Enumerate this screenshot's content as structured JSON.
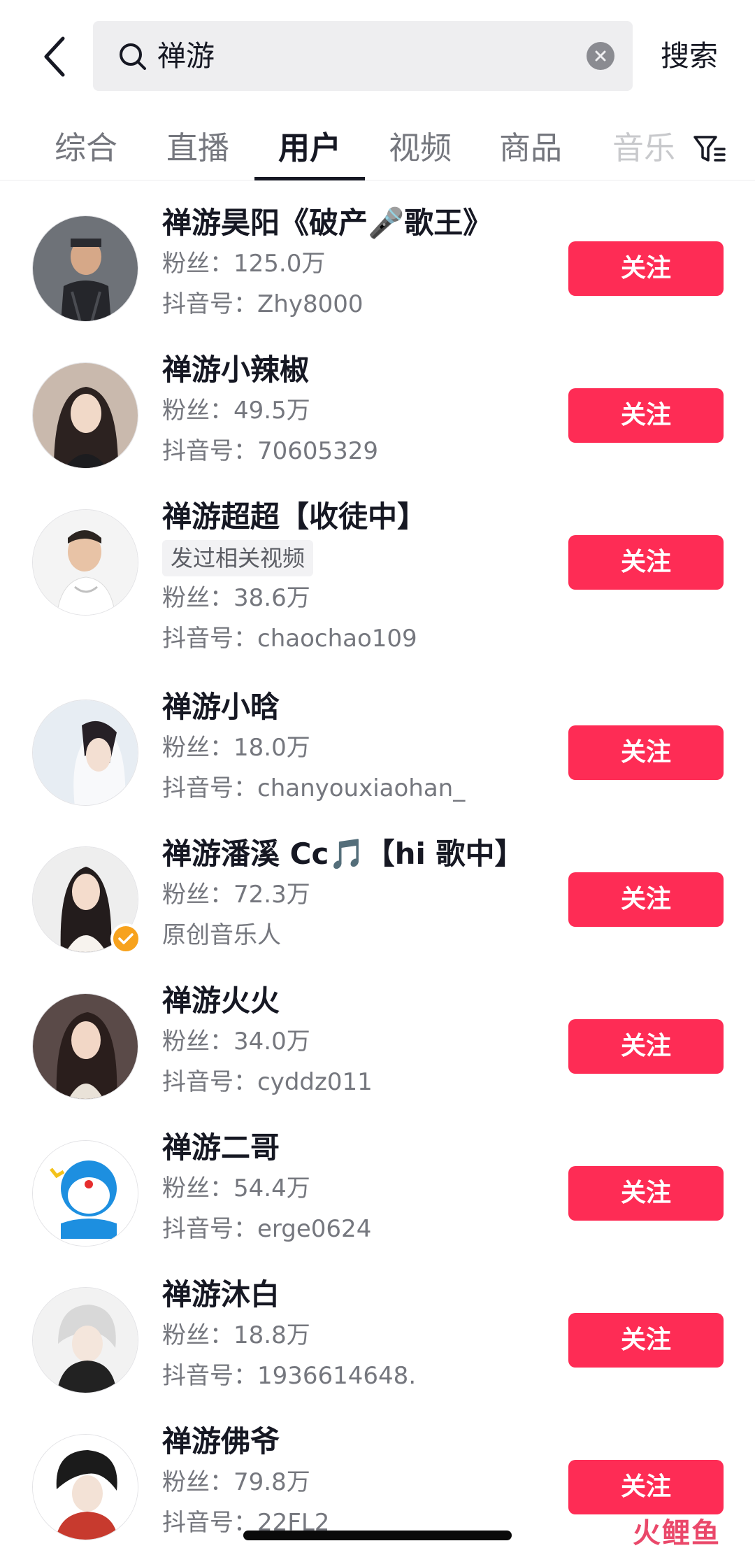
{
  "header": {
    "search_query": "禅游",
    "search_button": "搜索"
  },
  "tabs": [
    {
      "label": "综合",
      "active": false
    },
    {
      "label": "直播",
      "active": false
    },
    {
      "label": "用户",
      "active": true
    },
    {
      "label": "视频",
      "active": false
    },
    {
      "label": "商品",
      "active": false
    },
    {
      "label": "音乐",
      "active": false
    }
  ],
  "users": [
    {
      "name": "禅游昊阳《破产🎤歌王》",
      "fans": "粉丝：125.0万",
      "account": "抖音号：Zhy8000",
      "follow": "关注"
    },
    {
      "name": "禅游小辣椒",
      "fans": "粉丝：49.5万",
      "account": "抖音号：70605329",
      "follow": "关注"
    },
    {
      "name": "禅游超超【收徒中】",
      "tag": "发过相关视频",
      "fans": "粉丝：38.6万",
      "account": "抖音号：chaochao109",
      "follow": "关注"
    },
    {
      "name": "禅游小晗",
      "fans": "粉丝：18.0万",
      "account": "抖音号：chanyouxiaohan_",
      "follow": "关注"
    },
    {
      "name": "禅游潘溪 Cc🎵【hi 歌中】",
      "fans": "粉丝：72.3万",
      "account": "原创音乐人",
      "follow": "关注",
      "verified": true
    },
    {
      "name": "禅游火火",
      "fans": "粉丝：34.0万",
      "account": "抖音号：cyddz011",
      "follow": "关注"
    },
    {
      "name": "禅游二哥",
      "fans": "粉丝：54.4万",
      "account": "抖音号：erge0624",
      "follow": "关注"
    },
    {
      "name": "禅游沐白",
      "fans": "粉丝：18.8万",
      "account": "抖音号：1936614648.",
      "follow": "关注"
    },
    {
      "name": "禅游佛爷",
      "fans": "粉丝：79.8万",
      "account": "抖音号：22FL2",
      "follow": "关注"
    }
  ],
  "watermark": "火鲤鱼",
  "colors": {
    "accent": "#fe2c55",
    "badge": "#f7a21d",
    "secondary_text": "#75777e"
  },
  "icons": [
    "back-arrow-icon",
    "search-icon",
    "clear-icon",
    "filter-icon",
    "verified-icon"
  ]
}
